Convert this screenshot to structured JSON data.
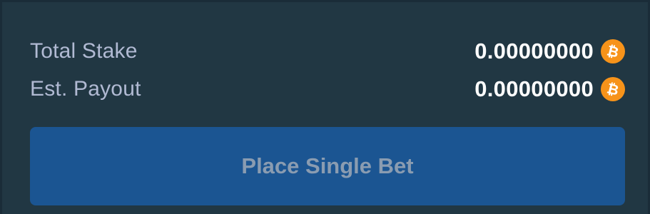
{
  "summary": {
    "total_stake": {
      "label": "Total Stake",
      "value": "0.00000000",
      "currency_icon": "bitcoin-icon"
    },
    "est_payout": {
      "label": "Est. Payout",
      "value": "0.00000000",
      "currency_icon": "bitcoin-icon"
    }
  },
  "actions": {
    "place_bet_label": "Place Single Bet",
    "place_bet_disabled": true
  },
  "colors": {
    "background": "#213743",
    "label": "#b1bad3",
    "value": "#ffffff",
    "coin": "#f7931a",
    "button_bg": "#1b5592",
    "button_text": "#8a9cb1"
  }
}
